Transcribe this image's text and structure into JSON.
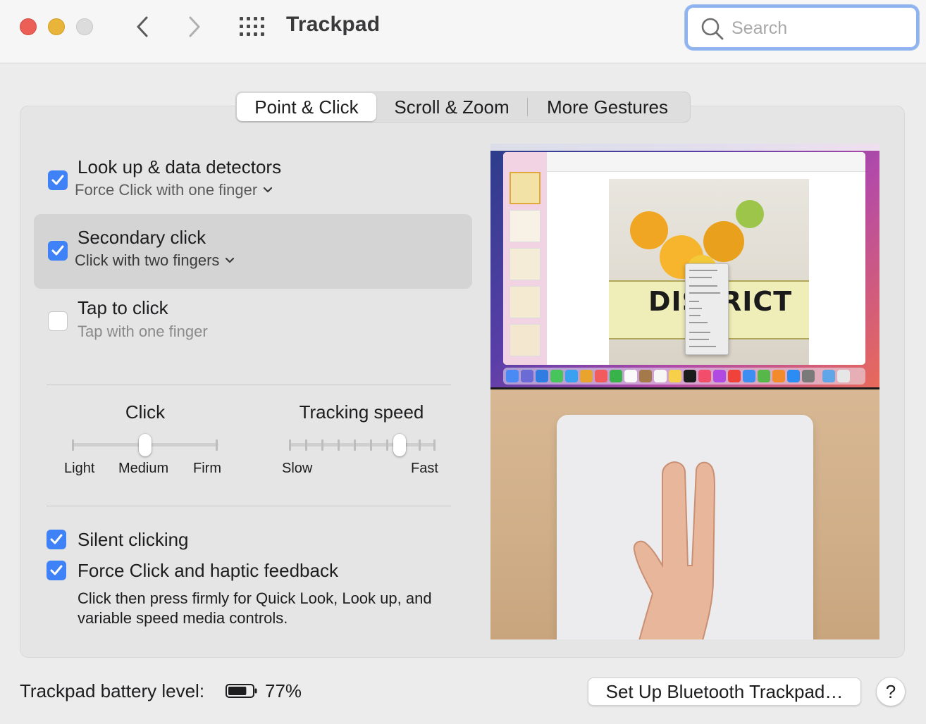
{
  "window": {
    "title": "Trackpad",
    "controls": [
      "close-button",
      "minimize-button",
      "zoom-button"
    ]
  },
  "toolbar": {
    "back_icon": "chevron-left-icon",
    "forward_icon": "chevron-right-icon",
    "grid_icon": "show-all-grid-icon",
    "search": {
      "placeholder": "Search",
      "value": "",
      "icon": "search-icon"
    }
  },
  "tabs": [
    {
      "label": "Point & Click",
      "selected": true
    },
    {
      "label": "Scroll & Zoom",
      "selected": false
    },
    {
      "label": "More Gestures",
      "selected": false
    }
  ],
  "options": [
    {
      "title": "Look up & data detectors",
      "subtitle": "Force Click with one finger",
      "checked": true,
      "has_dropdown": true,
      "selected": false
    },
    {
      "title": "Secondary click",
      "subtitle": "Click with two fingers",
      "checked": true,
      "has_dropdown": true,
      "selected": true
    },
    {
      "title": "Tap to click",
      "subtitle": "Tap with one finger",
      "checked": false,
      "has_dropdown": false,
      "selected": false
    }
  ],
  "sliders": {
    "click": {
      "title": "Click",
      "labels": [
        "Light",
        "Medium",
        "Firm"
      ],
      "steps": 3,
      "value_index": 1
    },
    "tracking": {
      "title": "Tracking speed",
      "min_label": "Slow",
      "max_label": "Fast",
      "steps": 10,
      "value_index": 7
    }
  },
  "bottom_options": [
    {
      "title": "Silent clicking",
      "checked": true
    },
    {
      "title": "Force Click and haptic feedback",
      "checked": true
    }
  ],
  "force_click_description": "Click then press firmly for Quick Look, Look up, and variable speed media controls.",
  "preview": {
    "banner_text": "DISTRICT"
  },
  "footer": {
    "battery_label": "Trackpad battery level:",
    "battery_percent": "77%",
    "battery_level": 0.77,
    "setup_button": "Set Up Bluetooth Trackpad…",
    "help_button": "?"
  },
  "colors": {
    "accent": "#3f82f7",
    "close": "#ec5f57",
    "minimize": "#e8b53a",
    "zoom_disabled": "#dcdcdc"
  }
}
